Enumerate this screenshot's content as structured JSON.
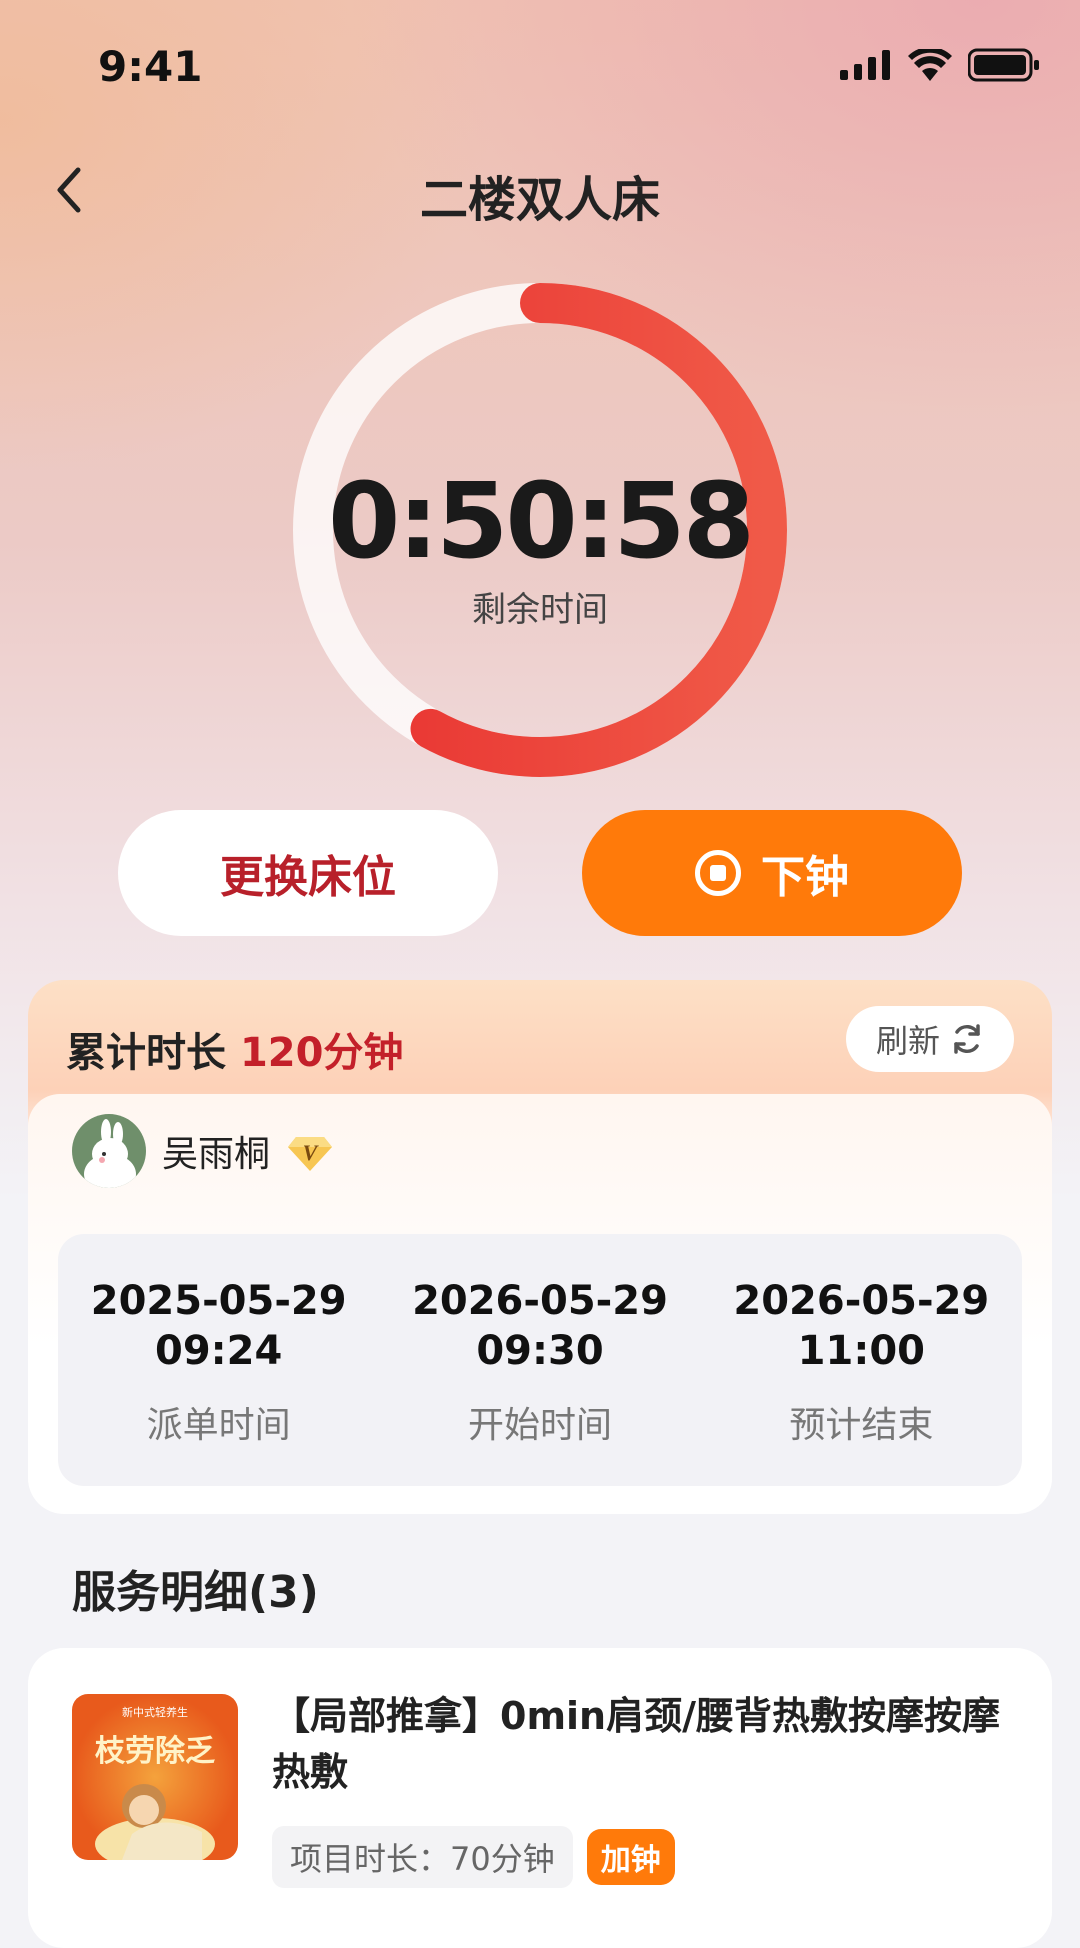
{
  "status_bar": {
    "time": "9:41"
  },
  "nav": {
    "title": "二楼双人床"
  },
  "timer": {
    "value": "0:50:58",
    "label": "剩余时间",
    "progress_remaining": 0.58
  },
  "actions": {
    "change_bed": "更换床位",
    "end_service": "下钟"
  },
  "summary": {
    "total_label": "累计时长 ",
    "total_value": "120分钟",
    "refresh_label": "刷新",
    "customer_name": "吴雨桐",
    "times": [
      {
        "date": "2025-05-29",
        "time": "09:24",
        "label": "派单时间"
      },
      {
        "date": "2026-05-29",
        "time": "09:30",
        "label": "开始时间"
      },
      {
        "date": "2026-05-29",
        "time": "11:00",
        "label": "预计结束"
      }
    ]
  },
  "service": {
    "section_title": "服务明细(3)",
    "items": [
      {
        "thumb_top": "新中式轻养生",
        "thumb_title": "枝劳除乏",
        "title": "【局部推拿】0min肩颈/腰背热敷按摩按摩热敷",
        "duration": "项目时长：70分钟",
        "tag": "加钟"
      }
    ]
  },
  "colors": {
    "accent_red": "#e63a36",
    "accent_orange": "#ff7a0a",
    "dark_red_text": "#b8202a"
  }
}
